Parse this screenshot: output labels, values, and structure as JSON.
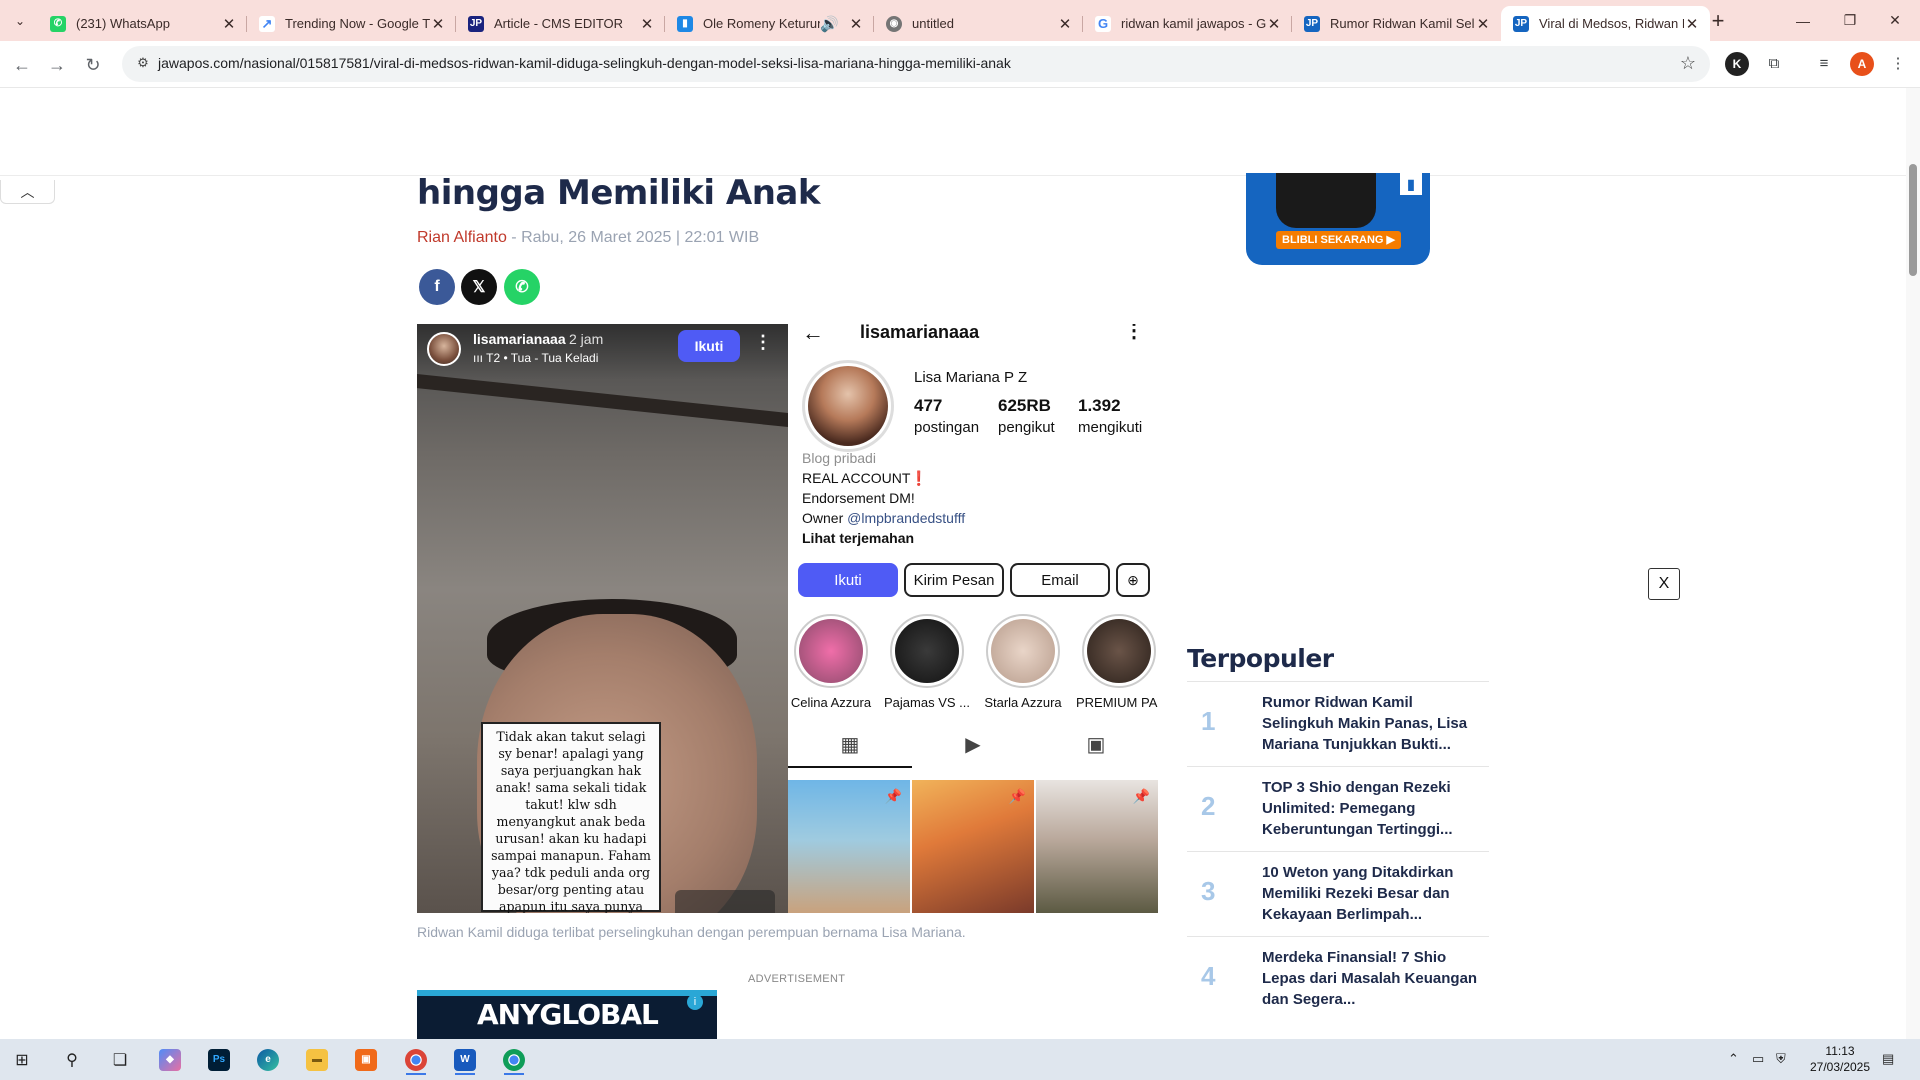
{
  "browser": {
    "tabs": [
      {
        "title": "(231) WhatsApp",
        "favicon": "whatsapp-icon",
        "color": "#25d366",
        "active": false
      },
      {
        "title": "Trending Now - Google Tr",
        "favicon": "google-trends-icon",
        "color": "#4285f4",
        "active": false
      },
      {
        "title": "Article - CMS EDITOR",
        "favicon": "cms-icon",
        "color": "#1a237e",
        "active": false
      },
      {
        "title": "Ole Romeny Keturuna",
        "favicon": "bookmark-icon",
        "color": "#1e88e5",
        "active": false
      },
      {
        "title": "untitled",
        "favicon": "globe-icon",
        "color": "#757575",
        "active": false
      },
      {
        "title": "ridwan kamil jawapos - G",
        "favicon": "google-icon",
        "color": "#4285f4",
        "active": false
      },
      {
        "title": "Rumor Ridwan Kamil Seli",
        "favicon": "jawapos-icon",
        "color": "#1565c0",
        "active": false
      },
      {
        "title": "Viral di Medsos, Ridwan K",
        "favicon": "jawapos-icon",
        "color": "#1565c0",
        "active": true
      }
    ],
    "url": "jawapos.com/nasional/015817581/viral-di-medsos-ridwan-kamil-diduga-selingkuh-dengan-model-seksi-lisa-mariana-hingga-memiliki-anak",
    "profile_initial": "A",
    "extension_initial": "K"
  },
  "article": {
    "headline": "hingga Memiliki Anak",
    "author": "Rian Alfianto",
    "date": "- Rabu, 26 Maret 2025 | 22:01 WIB",
    "share": {
      "facebook": "f",
      "x": "𝕏",
      "whatsapp": "✆"
    },
    "caption": "Ridwan Kamil diduga terlibat perselingkuhan dengan perempuan bernama Lisa Mariana.",
    "ad_label": "ADVERTISEMENT",
    "ad_brand": "ANYGLOBAL"
  },
  "story": {
    "username": "lisamarianaaa",
    "time": "2 jam",
    "music": "ııı T2 • Tua - Tua Keladi",
    "follow": "Ikuti",
    "note": "Tidak akan takut selagi sy benar! apalagi yang saya perjuangkan hak anak! sama sekali tidak takut! klw sdh menyangkut anak beda urusan! akan ku hadapi sampai manapun. Faham yaa? tdk peduli anda org besar/org penting atau apapun itu saya punya ALLAH!"
  },
  "profile": {
    "handle": "lisamarianaaa",
    "name": "Lisa Mariana P Z",
    "stats": [
      {
        "value": "477",
        "label": "postingan"
      },
      {
        "value": "625RB",
        "label": "pengikut"
      },
      {
        "value": "1.392",
        "label": "mengikuti"
      }
    ],
    "category": "Blog pribadi",
    "bio1": "REAL ACCOUNT❗",
    "bio2": "Endorsement DM!",
    "owner_prefix": "Owner ",
    "owner_link": "@lmpbrandedstufff",
    "translate": "Lihat terjemahan",
    "buttons": {
      "follow": "Ikuti",
      "message": "Kirim Pesan",
      "email": "Email"
    },
    "highlights": [
      "Celina Azzura",
      "Pajamas VS ...",
      "Starla Azzura",
      "PREMIUM PA..."
    ]
  },
  "sidebar": {
    "ad_cta": "BLIBLI SEKARANG ▶",
    "close": "X",
    "popular_title": "Terpopuler",
    "popular": [
      {
        "rank": "1",
        "title": "Rumor Ridwan Kamil Selingkuh Makin Panas, Lisa Mariana Tunjukkan Bukti..."
      },
      {
        "rank": "2",
        "title": "TOP 3 Shio dengan Rezeki Unlimited: Pemegang Keberuntungan Tertinggi..."
      },
      {
        "rank": "3",
        "title": "10 Weton yang Ditakdirkan Memiliki Rezeki Besar dan Kekayaan Berlimpah..."
      },
      {
        "rank": "4",
        "title": "Merdeka Finansial! 7 Shio Lepas dari Masalah Keuangan dan Segera..."
      }
    ]
  },
  "taskbar": {
    "time": "11:13",
    "date": "27/03/2025"
  }
}
